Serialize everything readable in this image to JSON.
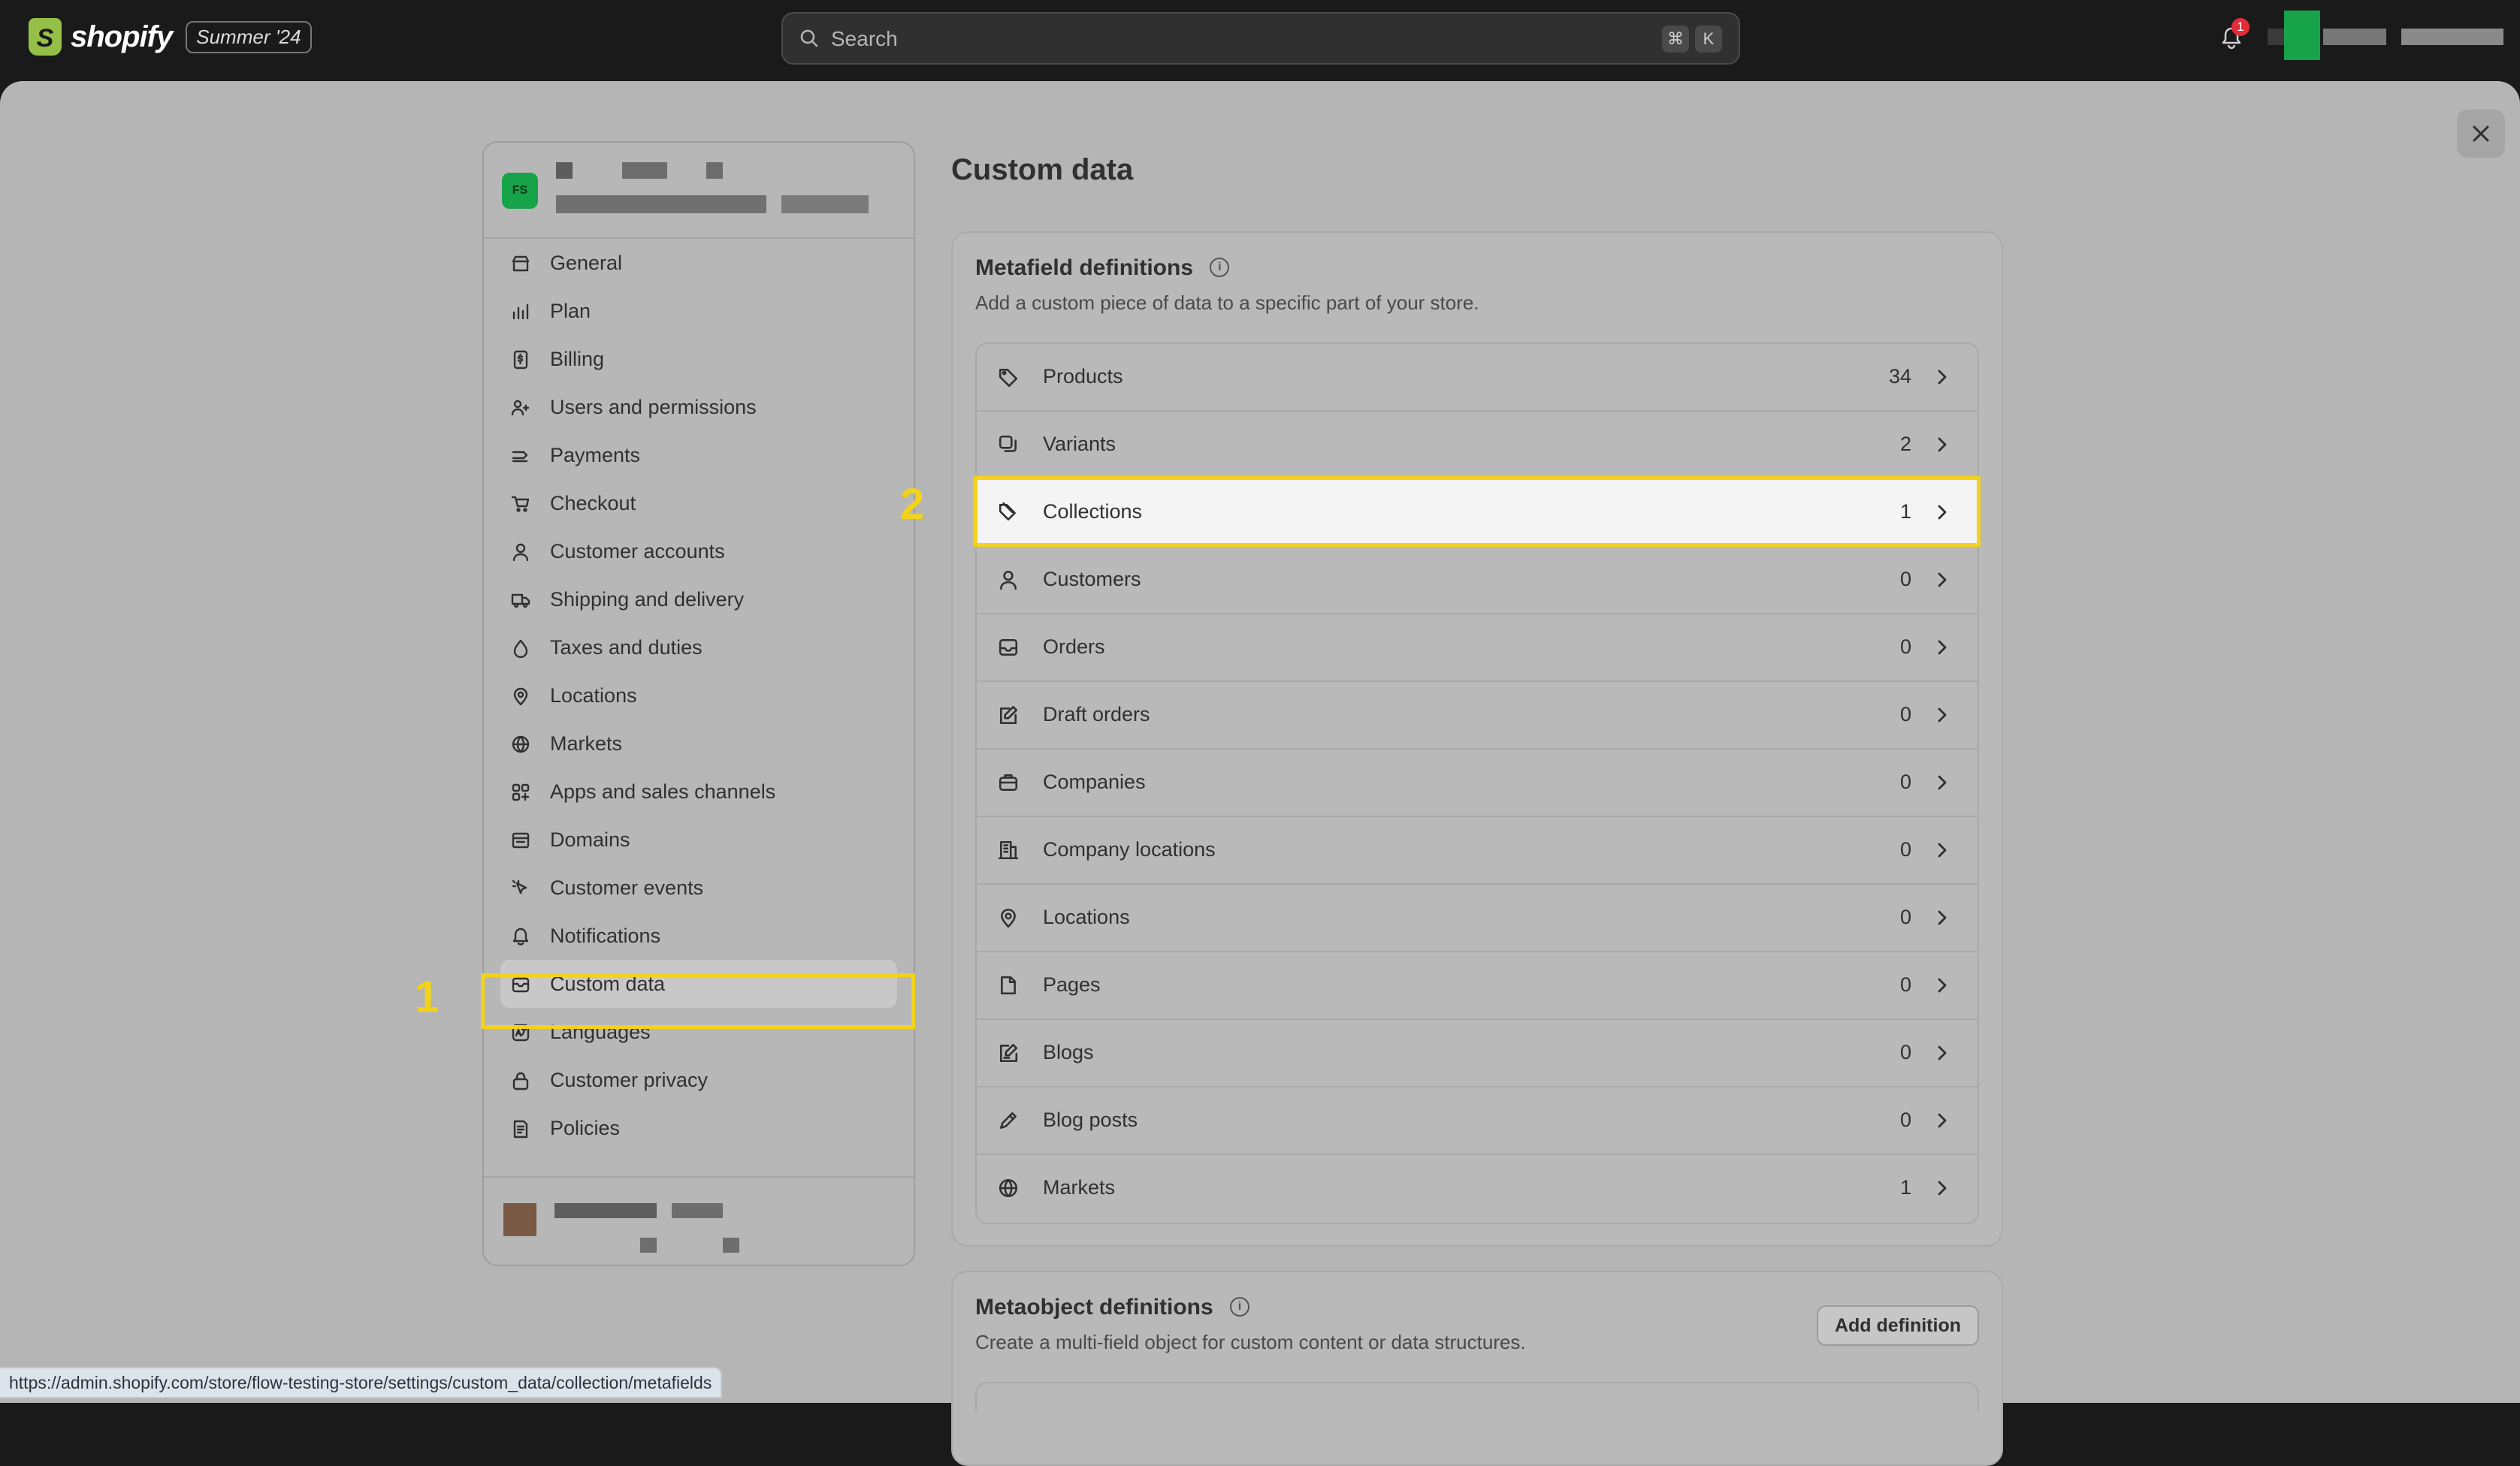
{
  "topbar": {
    "logo_text": "shopify",
    "edition_badge": "Summer '24",
    "search_placeholder": "Search",
    "shortcut_keys": [
      "⌘",
      "K"
    ],
    "notification_count": "1"
  },
  "sidebar": {
    "store_initials": "FS",
    "items": [
      {
        "label": "General",
        "icon": "store-icon"
      },
      {
        "label": "Plan",
        "icon": "plan-icon"
      },
      {
        "label": "Billing",
        "icon": "billing-icon"
      },
      {
        "label": "Users and permissions",
        "icon": "users-icon"
      },
      {
        "label": "Payments",
        "icon": "payments-icon"
      },
      {
        "label": "Checkout",
        "icon": "cart-icon"
      },
      {
        "label": "Customer accounts",
        "icon": "person-icon"
      },
      {
        "label": "Shipping and delivery",
        "icon": "truck-icon"
      },
      {
        "label": "Taxes and duties",
        "icon": "tax-icon"
      },
      {
        "label": "Locations",
        "icon": "location-icon"
      },
      {
        "label": "Markets",
        "icon": "globe-icon"
      },
      {
        "label": "Apps and sales channels",
        "icon": "apps-icon"
      },
      {
        "label": "Domains",
        "icon": "domain-icon"
      },
      {
        "label": "Customer events",
        "icon": "cursor-icon"
      },
      {
        "label": "Notifications",
        "icon": "bell-icon"
      },
      {
        "label": "Custom data",
        "icon": "database-icon",
        "active": true
      },
      {
        "label": "Languages",
        "icon": "language-icon"
      },
      {
        "label": "Customer privacy",
        "icon": "lock-icon"
      },
      {
        "label": "Policies",
        "icon": "policy-icon"
      }
    ]
  },
  "annotations": {
    "step1": "1",
    "step2": "2",
    "highlight_color": "#f2d21b"
  },
  "main": {
    "title": "Custom data",
    "metafields": {
      "title": "Metafield definitions",
      "subtitle": "Add a custom piece of data to a specific part of your store.",
      "rows": [
        {
          "label": "Products",
          "count": "34",
          "icon": "tag-icon"
        },
        {
          "label": "Variants",
          "count": "2",
          "icon": "variants-icon"
        },
        {
          "label": "Collections",
          "count": "1",
          "icon": "collection-icon",
          "active": true
        },
        {
          "label": "Customers",
          "count": "0",
          "icon": "person-icon"
        },
        {
          "label": "Orders",
          "count": "0",
          "icon": "inbox-icon"
        },
        {
          "label": "Draft orders",
          "count": "0",
          "icon": "draft-icon"
        },
        {
          "label": "Companies",
          "count": "0",
          "icon": "briefcase-icon"
        },
        {
          "label": "Company locations",
          "count": "0",
          "icon": "building-icon"
        },
        {
          "label": "Locations",
          "count": "0",
          "icon": "location-icon"
        },
        {
          "label": "Pages",
          "count": "0",
          "icon": "page-icon"
        },
        {
          "label": "Blogs",
          "count": "0",
          "icon": "blog-icon"
        },
        {
          "label": "Blog posts",
          "count": "0",
          "icon": "pen-icon"
        },
        {
          "label": "Markets",
          "count": "1",
          "icon": "globe-icon"
        }
      ]
    },
    "metaobjects": {
      "title": "Metaobject definitions",
      "subtitle": "Create a multi-field object for custom content or data structures.",
      "add_button": "Add definition"
    }
  },
  "statusbar": {
    "url": "https://admin.shopify.com/store/flow-testing-store/settings/custom_data/collection/metafields"
  }
}
